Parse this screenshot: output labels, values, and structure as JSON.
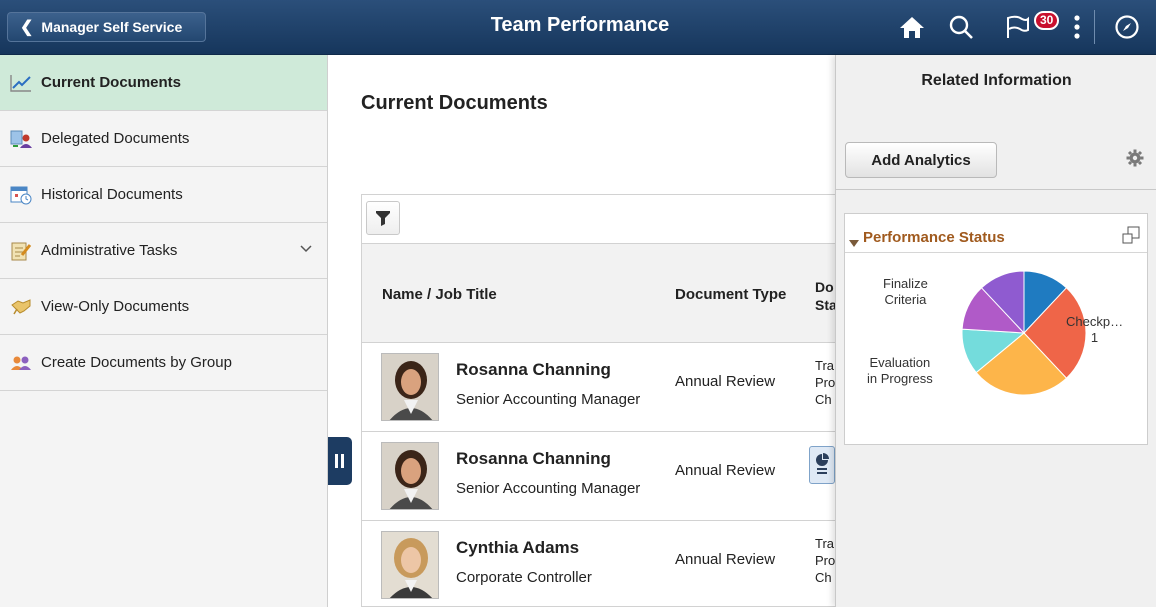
{
  "header": {
    "back_label": "Manager Self Service",
    "title": "Team Performance",
    "notification_count": "30"
  },
  "sidebar": {
    "items": [
      {
        "label": "Current Documents",
        "icon": "line-chart-icon"
      },
      {
        "label": "Delegated Documents",
        "icon": "delegate-icon"
      },
      {
        "label": "Historical Documents",
        "icon": "calendar-clock-icon"
      },
      {
        "label": "Administrative Tasks",
        "icon": "notepad-icon"
      },
      {
        "label": "View-Only Documents",
        "icon": "handshake-icon"
      },
      {
        "label": "Create Documents by Group",
        "icon": "group-icon"
      }
    ]
  },
  "main": {
    "title": "Current Documents",
    "columns": [
      "Name / Job Title",
      "Document Type",
      "Do",
      "Sta"
    ],
    "rows": [
      {
        "name": "Rosanna Channing",
        "job": "Senior Accounting Manager",
        "doc_type": "Annual Review",
        "status_lines": [
          "Tra",
          "Pro",
          "Ch"
        ]
      },
      {
        "name": "Rosanna Channing",
        "job": "Senior Accounting Manager",
        "doc_type": "Annual Review",
        "status_lines": []
      },
      {
        "name": "Cynthia Adams",
        "job": "Corporate Controller",
        "doc_type": "Annual Review",
        "status_lines": [
          "Tra",
          "Pro",
          "Ch"
        ]
      }
    ]
  },
  "related": {
    "title": "Related Information",
    "add_analytics": "Add Analytics",
    "tile_title": "Performance Status",
    "pie_labels": {
      "finalize": "Finalize\nCriteria",
      "checkpoint": "Checkp…\n1",
      "evaluation": "Evaluation\nin Progress"
    }
  },
  "chart_data": {
    "type": "pie",
    "title": "Performance Status",
    "slices": [
      {
        "label": "",
        "value": 12,
        "color": "#1f7bc1"
      },
      {
        "label": "Checkp… 1",
        "value": 26,
        "color": "#ef6548"
      },
      {
        "label": "",
        "value": 26,
        "color": "#fdb54a"
      },
      {
        "label": "Evaluation in Progress",
        "value": 12,
        "color": "#74dcdc"
      },
      {
        "label": "Finalize Criteria",
        "value": 12,
        "color": "#b05ac8"
      },
      {
        "label": "",
        "value": 12,
        "color": "#8f5bd0"
      }
    ]
  }
}
